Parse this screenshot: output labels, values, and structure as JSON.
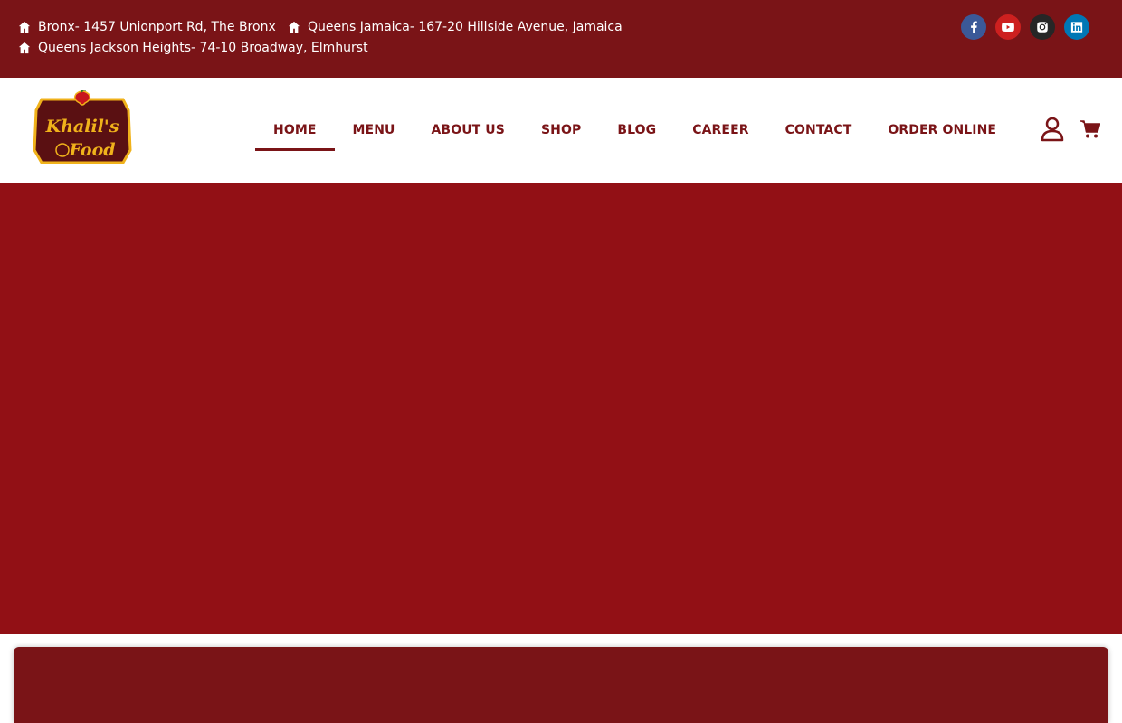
{
  "topbar": {
    "addresses": [
      "Bronx- 1457 Unionport Rd, The Bronx",
      "Queens Jamaica- 167-20 Hillside Avenue, Jamaica",
      "Queens Jackson Heights- 74-10 Broadway, Elmhurst"
    ],
    "social": [
      "facebook-icon",
      "youtube-icon",
      "instagram-icon",
      "linkedin-icon"
    ]
  },
  "header": {
    "logo": {
      "line1": "Khalil's",
      "line2": "Food"
    },
    "nav": [
      "HOME",
      "MENU",
      "ABOUT US",
      "SHOP",
      "BLOG",
      "CAREER",
      "CONTACT",
      "ORDER ONLINE"
    ],
    "active_nav": "HOME"
  },
  "colors": {
    "brand": "#7a1417",
    "hero": "#921015",
    "logo_gold": "#f0b21b"
  }
}
